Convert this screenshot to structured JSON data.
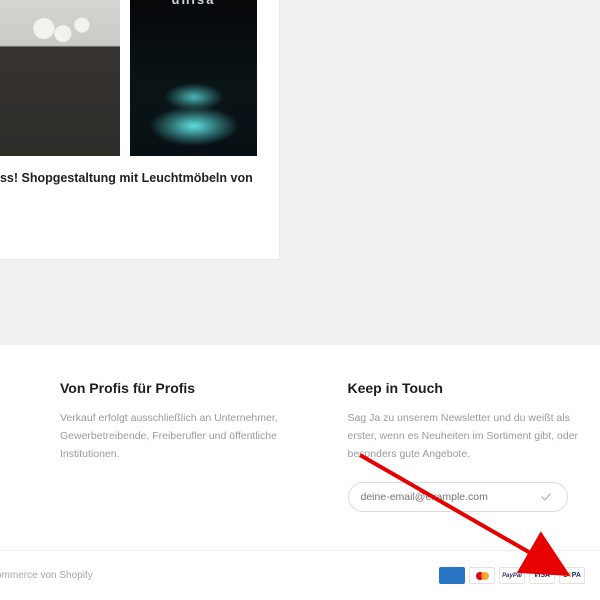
{
  "card": {
    "title": "ess! Shopgestaltung mit Leuchtmöbeln von",
    "thumb2_sign": "unisa"
  },
  "footer": {
    "col1": {
      "heading": "Von Profis für Profis",
      "text": "Verkauf erfolgt ausschließlich an Unternehmer, Gewerbetreibende, Freiberufler und öffentliche Institutionen."
    },
    "col2": {
      "heading": "Keep in Touch",
      "text": "Sag Ja zu unserem Newsletter und du weißt als erster, wenn es Neuheiten im Sortiment gibt, oder besonders gute Angebote.",
      "placeholder": "deine-email@example.com"
    }
  },
  "bottom": {
    "legal": "ommerce von Shopify",
    "badges": {
      "amex": "AMEX",
      "paypal": "PayPal",
      "visa": "VISA",
      "sepa_s": "S",
      "sepa_e": "€",
      "sepa_pa": "PA"
    }
  },
  "annotation": {
    "arrow_target": "payment-badges"
  }
}
